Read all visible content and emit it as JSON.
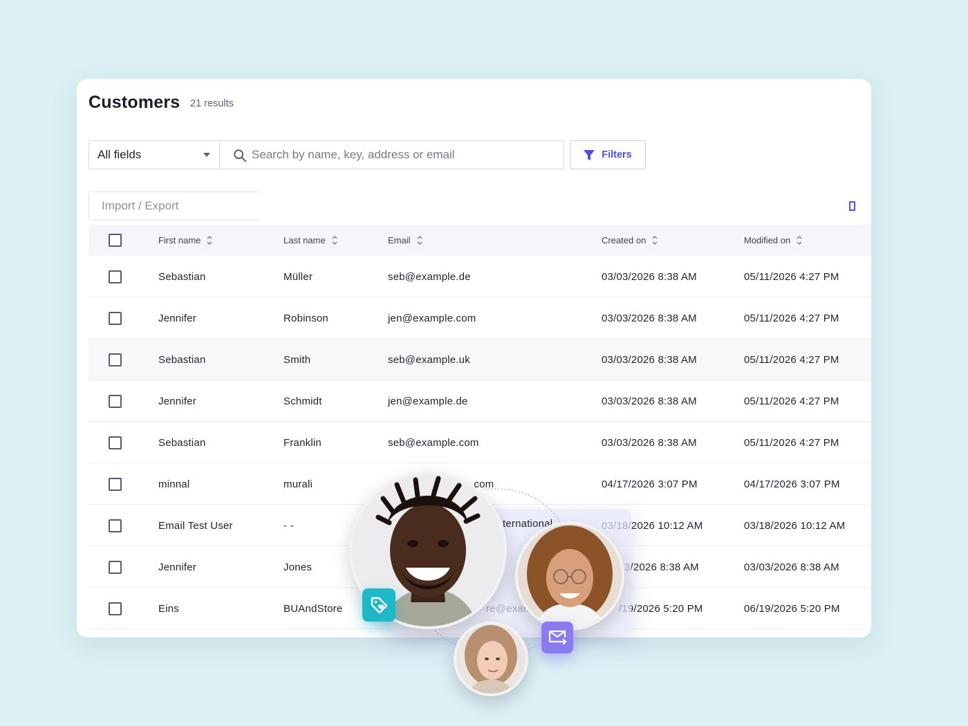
{
  "header": {
    "title": "Customers",
    "results": "21 results"
  },
  "toolbar": {
    "field_select": "All fields",
    "search_placeholder": "Search by name, key, address or email",
    "filters_label": "Filters",
    "import_export_label": "Import / Export"
  },
  "table": {
    "columns": [
      "First name",
      "Last name",
      "Email",
      "Created on",
      "Modified on"
    ],
    "rows": [
      {
        "first": "Sebastian",
        "last": "Müller",
        "email": "seb@example.de",
        "created": "03/03/2026 8:38 AM",
        "modified": "05/11/2026 4:27 PM"
      },
      {
        "first": "Jennifer",
        "last": "Robinson",
        "email": "jen@example.com",
        "created": "03/03/2026 8:38 AM",
        "modified": "05/11/2026 4:27 PM"
      },
      {
        "first": "Sebastian",
        "last": "Smith",
        "email": "seb@example.uk",
        "created": "03/03/2026 8:38 AM",
        "modified": "05/11/2026 4:27 PM"
      },
      {
        "first": "Jennifer",
        "last": "Schmidt",
        "email": "jen@example.de",
        "created": "03/03/2026 8:38 AM",
        "modified": "05/11/2026 4:27 PM"
      },
      {
        "first": "Sebastian",
        "last": "Franklin",
        "email": "seb@example.com",
        "created": "03/03/2026 8:38 AM",
        "modified": "05/11/2026 4:27 PM"
      },
      {
        "first": "minnal",
        "last": "murali",
        "email": ".com",
        "created": "04/17/2026 3:07 PM",
        "modified": "04/17/2026 3:07 PM"
      },
      {
        "first": "Email Test User",
        "last": "- -",
        "email": "",
        "created": "03/18/2026 10:12 AM",
        "modified": "03/18/2026 10:12 AM"
      },
      {
        "first": "Jennifer",
        "last": "Jones",
        "email": "",
        "created": "3/2026 8:38 AM",
        "modified": "03/03/2026 8:38 AM"
      },
      {
        "first": "Eins",
        "last": "BUAndStore",
        "email": "re@examp",
        "created": "/19/2026 5:20 PM",
        "modified": "06/19/2026 5:20 PM"
      }
    ]
  },
  "overlay": {
    "partial_email_row7": "ternational",
    "partial_email_row6": "com"
  },
  "icons": {
    "search": "search-icon",
    "dropdown": "chevron-down-icon",
    "filter": "filter-icon",
    "columns": "columns-icon",
    "sort": "sort-icon",
    "tag": "tag-icon",
    "mail": "mail-forward-icon"
  },
  "colors": {
    "accent": "#4c4fdb",
    "background": "#dcf0f5",
    "tag_badge": "#1fb8c8",
    "mail_badge": "#8a7cf0"
  }
}
